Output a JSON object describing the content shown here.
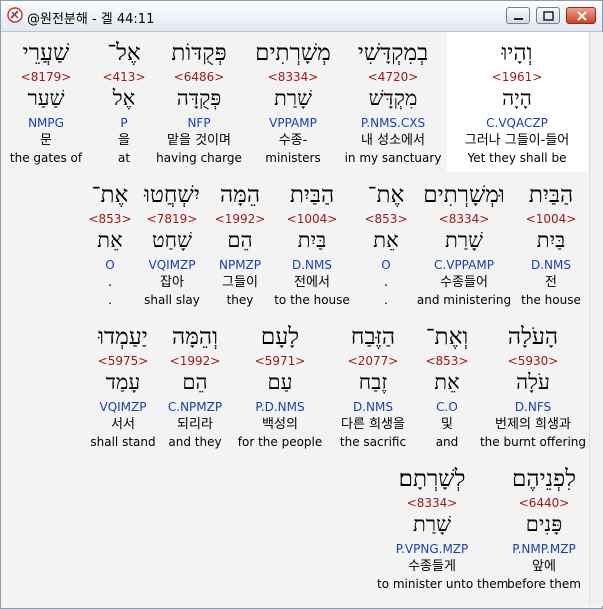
{
  "window": {
    "title": "@원전분해 - 겔 44:11"
  },
  "rows": [
    [
      {
        "heb1": "וְהָיוּ",
        "strong": "<1961>",
        "heb2": "הָיָה",
        "morph": "C.VQACZP",
        "korean": "그러나 그들이-들어",
        "english": "Yet they shall be",
        "highlight": true
      },
      {
        "heb1": "בְמִקְדָּשִׁי",
        "strong": "<4720>",
        "heb2": "מִקְדָּשׁ",
        "morph": "P.NMS.CXS",
        "korean": "내 성소에서",
        "english": "in my sanctuary"
      },
      {
        "heb1": "מְשָׁרְתִים",
        "strong": "<8334>",
        "heb2": "שָׁרַת",
        "morph": "VPPAMP",
        "korean": "수종-",
        "english": "ministers"
      },
      {
        "heb1": "פְּקֻדּוֹת",
        "strong": "<6486>",
        "heb2": "פְּקֻדָּה",
        "morph": "NFP",
        "korean": "맡을 것이며",
        "english": "having charge"
      },
      {
        "heb1": "אֶל־",
        "strong": "<413>",
        "heb2": "אֶל",
        "morph": "P",
        "korean": "을",
        "english": "at"
      },
      {
        "heb1": "שַׁעֲרֵי",
        "strong": "<8179>",
        "heb2": "שַׁעַר",
        "morph": "NMPG",
        "korean": "문",
        "english": "the gates of"
      }
    ],
    [
      {
        "heb1": "הַבַּיִת",
        "strong": "<1004>",
        "heb2": "בַּיִת",
        "morph": "D.NMS",
        "korean": "전",
        "english": "the house"
      },
      {
        "heb1": "וּמְשָׁרְתִים",
        "strong": "<8334>",
        "heb2": "שָׁרַת",
        "morph": "C.VPPAMP",
        "korean": "수종들어",
        "english": "and ministering"
      },
      {
        "heb1": "אֶת־",
        "strong": "<853>",
        "heb2": "אֵת",
        "morph": "O",
        "korean": ".",
        "english": "."
      },
      {
        "heb1": "הַבַּיִת",
        "strong": "<1004>",
        "heb2": "בַּיִת",
        "morph": "D.NMS",
        "korean": "전에서",
        "english": "to the house"
      },
      {
        "heb1": "הֵמָּה",
        "strong": "<1992>",
        "heb2": "הֵם",
        "morph": "NPMZP",
        "korean": "그들이",
        "english": "they"
      },
      {
        "heb1": "יִשְׁחֲטוּ",
        "strong": "<7819>",
        "heb2": "שָׁחַט",
        "morph": "VQIMZP",
        "korean": "잡아",
        "english": "shall slay"
      },
      {
        "heb1": "אֶת־",
        "strong": "<853>",
        "heb2": "אֵת",
        "morph": "O",
        "korean": ".",
        "english": "."
      }
    ],
    [
      {
        "heb1": "הָעֹלָה",
        "strong": "<5930>",
        "heb2": "עֹלָה",
        "morph": "D.NFS",
        "korean": "번제의 희생과",
        "english": "the burnt offering"
      },
      {
        "heb1": "וְאֶת־",
        "strong": "<853>",
        "heb2": "אֵת",
        "morph": "C.O",
        "korean": "및",
        "english": "and"
      },
      {
        "heb1": "הַזֶּבַח",
        "strong": "<2077>",
        "heb2": "זֶבַח",
        "morph": "D.NMS",
        "korean": "다른 희생을",
        "english": "the sacrific"
      },
      {
        "heb1": "לָעָם",
        "strong": "<5971>",
        "heb2": "עַם",
        "morph": "P.D.NMS",
        "korean": "백성의",
        "english": "for the people"
      },
      {
        "heb1": "וְהֵמָּה",
        "strong": "<1992>",
        "heb2": "הֵם",
        "morph": "C.NPMZP",
        "korean": "되리라",
        "english": "and they"
      },
      {
        "heb1": "יַעַמְדוּ",
        "strong": "<5975>",
        "heb2": "עָמַד",
        "morph": "VQIMZP",
        "korean": "서서",
        "english": "shall stand"
      }
    ],
    [
      {
        "heb1": "לִפְנֵיהֶם",
        "strong": "<6440>",
        "heb2": "פָּנִים",
        "morph": "P.NMP.MZP",
        "korean": "앞에",
        "english": "before them"
      },
      {
        "heb1": "לְשָׁרְתָם׃",
        "strong": "<8334>",
        "heb2": "שָׁרַת",
        "morph": "P.VPNG.MZP",
        "korean": "수종들게",
        "english": "to minister unto them"
      }
    ]
  ]
}
